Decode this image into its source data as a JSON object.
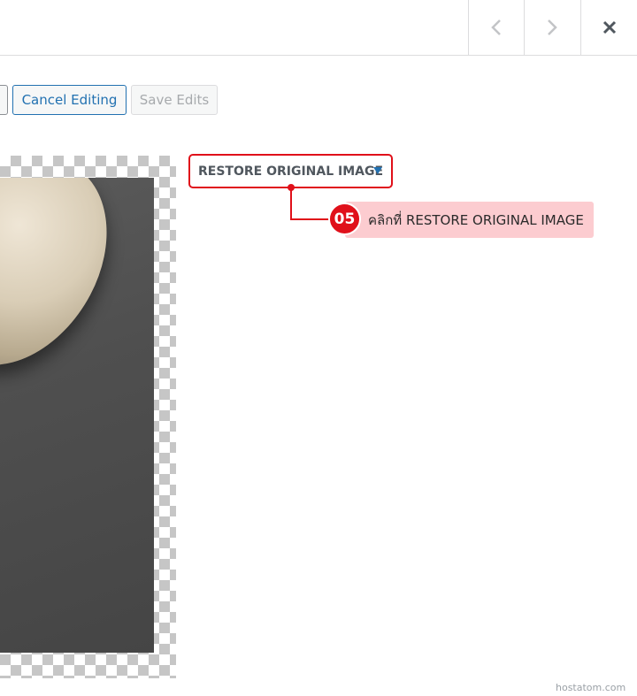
{
  "toolbar": {
    "cancel_label": "Cancel Editing",
    "save_label": "Save Edits"
  },
  "nav": {
    "prev_icon": "chevron-left-icon",
    "next_icon": "chevron-right-icon",
    "close_icon": "close-icon"
  },
  "restore": {
    "label": "RESTORE ORIGINAL IMAGE",
    "caret_color": "#2271b1",
    "highlight_color": "#e0101a"
  },
  "callout": {
    "step": "05",
    "text": "คลิกที่ RESTORE ORIGINAL IMAGE",
    "background_color": "#fcccd0"
  },
  "watermark": "hostatom.com"
}
